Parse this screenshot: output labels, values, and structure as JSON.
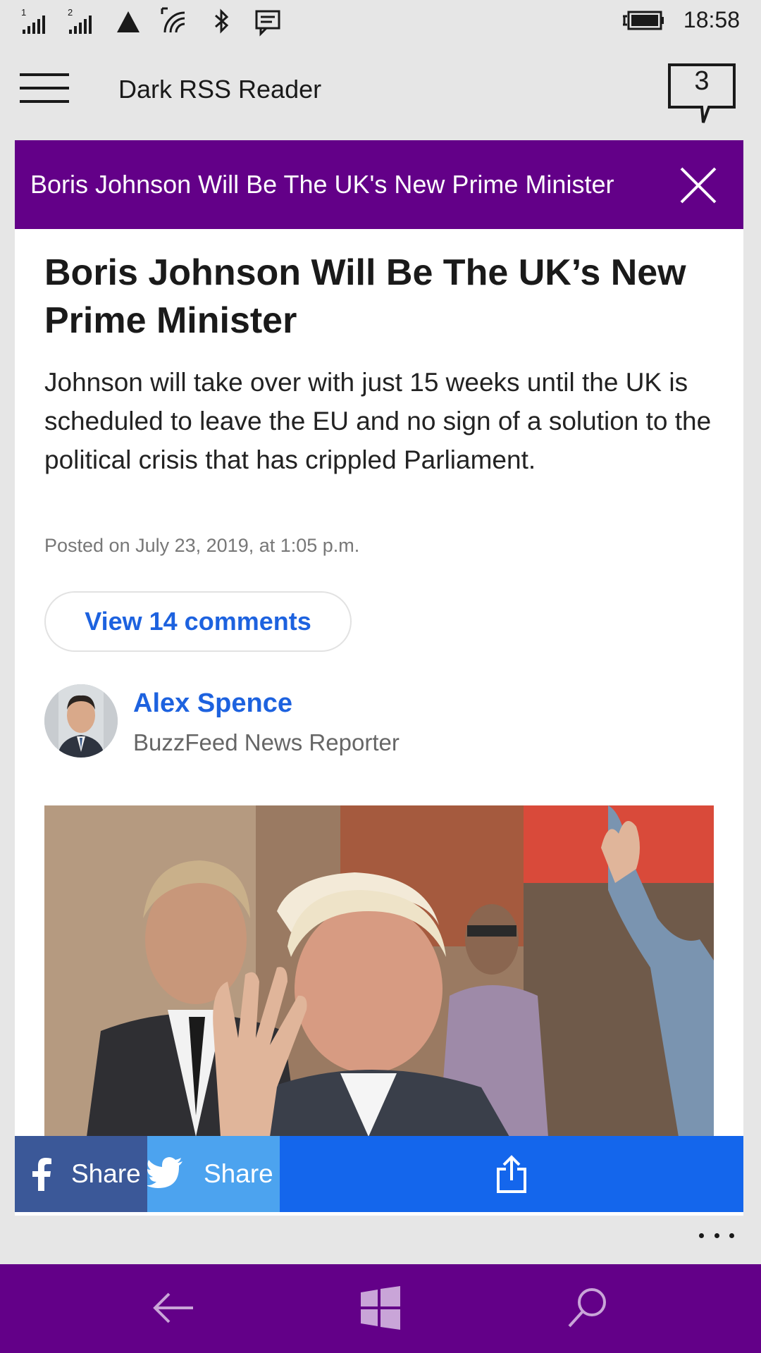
{
  "status_bar": {
    "sim1": "1",
    "sim2": "2",
    "time": "18:58",
    "icons": [
      "signal-sim1-icon",
      "signal-sim2-icon",
      "warning-triangle-icon",
      "wifi-icon",
      "bluetooth-icon",
      "message-icon",
      "battery-charging-icon"
    ]
  },
  "app_bar": {
    "title": "Dark RSS Reader",
    "notification_count": "3"
  },
  "banner": {
    "text": "Boris Johnson Will Be The UK's New Prime Minister"
  },
  "article": {
    "headline": "Boris Johnson Will Be The UK’s New Prime Minister",
    "summary": "Johnson will take over with just 15 weeks until the UK is scheduled to leave the EU and no sign of a solution to the political crisis that has crippled Parliament.",
    "posted": "Posted on July 23, 2019, at 1:05 p.m.",
    "comments_button": "View 14 comments",
    "author": {
      "name": "Alex Spence",
      "role": "BuzzFeed News Reporter"
    }
  },
  "share_bar": {
    "facebook_label": "Share",
    "twitter_label": "Share",
    "colors": {
      "facebook": "#3b5898",
      "twitter": "#4ca3ef",
      "generic": "#1466ec"
    }
  },
  "theme": {
    "accent": "#630088",
    "link": "#1d62df"
  }
}
